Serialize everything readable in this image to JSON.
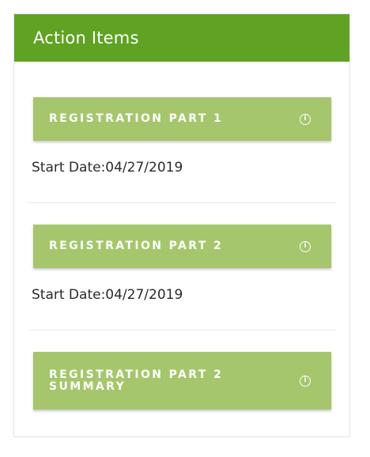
{
  "panel": {
    "title": "Action Items",
    "header_color": "#5fa224",
    "button_color": "#a5c66c"
  },
  "items": [
    {
      "label": "REGISTRATION PART 1",
      "icon": "info-icon",
      "start_date": "Start Date:04/27/2019"
    },
    {
      "label": "REGISTRATION PART 2",
      "icon": "info-icon",
      "start_date": "Start Date:04/27/2019"
    },
    {
      "label": "REGISTRATION PART 2 SUMMARY",
      "icon": "info-icon"
    }
  ]
}
